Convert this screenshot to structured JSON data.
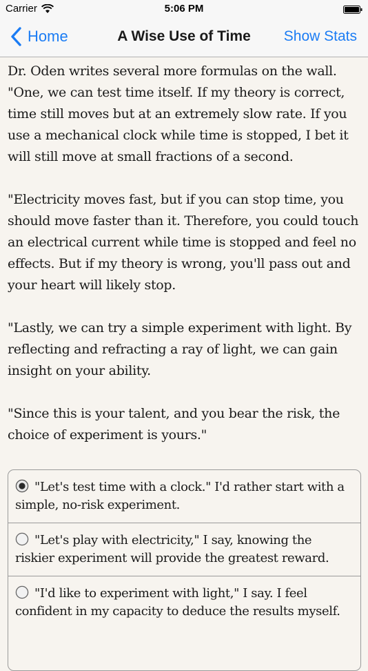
{
  "status": {
    "carrier": "Carrier",
    "time": "5:06 PM"
  },
  "nav": {
    "back_label": "Home",
    "title": "A Wise Use of Time",
    "right_label": "Show Stats"
  },
  "story": {
    "paragraphs": [
      "Dr. Oden writes several more formulas on the wall. \"One, we can test time itself. If my theory is correct, time still moves but at an extremely slow rate. If you use a mechanical clock while time is stopped, I bet it will still move at small fractions of a second.",
      "\"Electricity moves fast, but if you can stop time, you should move faster than it. Therefore, you could touch an electrical current while time is stopped and feel no effects. But if my theory is wrong, you'll pass out and your heart will likely stop.",
      "\"Lastly, we can try a simple experiment with light. By reflecting and refracting a ray of light, we can gain insight on your ability.",
      "\"Since this is your talent, and you bear the risk, the choice of experiment is yours.\""
    ]
  },
  "choices": {
    "items": [
      {
        "text": "\"Let's test time with a clock.\" I'd rather start with a simple, no-risk experiment.",
        "selected": true
      },
      {
        "text": "\"Let's play with electricity,\" I say, knowing the riskier experiment will provide the greatest reward.",
        "selected": false
      },
      {
        "text": "\"I'd like to experiment with light,\" I say. I feel confident in my capacity to deduce the results myself.",
        "selected": false
      }
    ]
  },
  "colors": {
    "accent": "#1b7cf4",
    "background": "#f7f4ef"
  }
}
